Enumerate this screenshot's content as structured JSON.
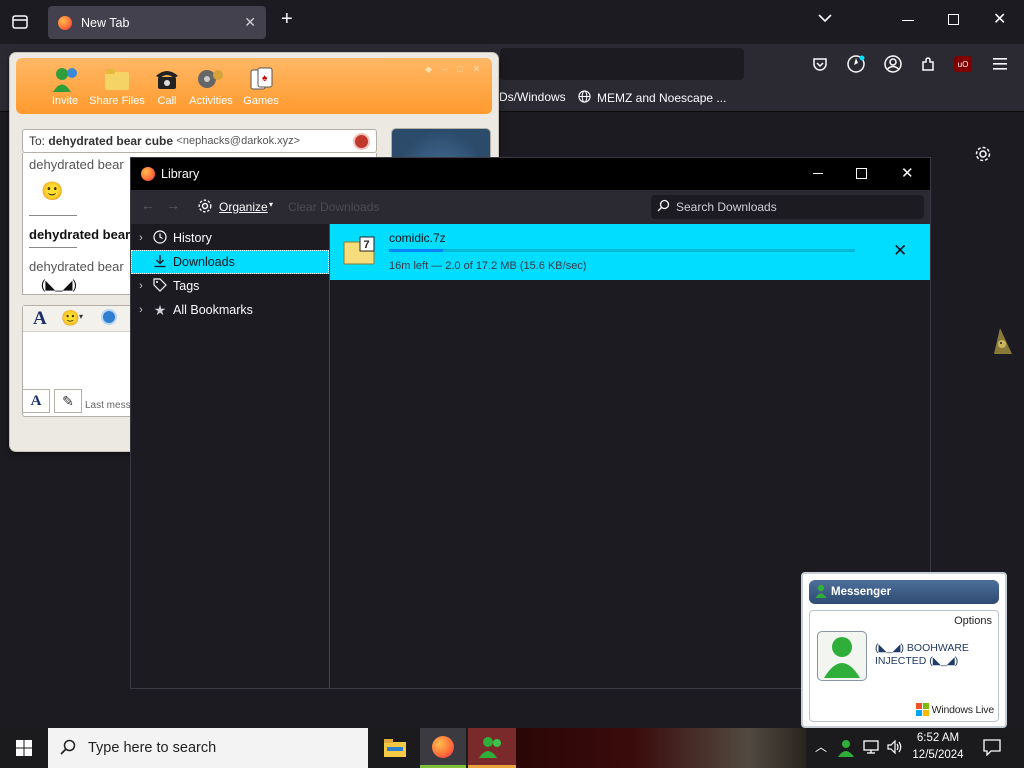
{
  "browser": {
    "tab_title": "New Tab",
    "tab_close": "✕",
    "new_tab": "+",
    "bookmarks": [
      "Ds/Windows",
      "MEMZ and Noescape ..."
    ],
    "ublock_badge": "uO"
  },
  "msn": {
    "toolbar": [
      {
        "label": "Invite",
        "icon": "invite-icon"
      },
      {
        "label": "Share Files",
        "icon": "folder-icon"
      },
      {
        "label": "Call",
        "icon": "phone-icon"
      },
      {
        "label": "Activities",
        "icon": "activities-icon"
      },
      {
        "label": "Games",
        "icon": "games-icon"
      }
    ],
    "to_prefix": "To:",
    "to_name": "dehydrated bear cube",
    "to_email": "<nephacks@darkok.xyz>",
    "conversation": [
      {
        "text": "dehydrated bear",
        "bold": false
      },
      {
        "text": "🙂",
        "bold": false
      },
      {
        "text": "dehydrated bear",
        "bold": true
      },
      {
        "text": "dehydrated bear",
        "bold": false
      },
      {
        "text": "(◣_◢)",
        "bold": false
      }
    ],
    "last_message": "Last mess"
  },
  "library": {
    "title": "Library",
    "organize": "Organize",
    "clear_downloads": "Clear Downloads",
    "search_placeholder": "Search Downloads",
    "sidebar": [
      {
        "label": "History",
        "icon": "clock-icon",
        "expandable": true
      },
      {
        "label": "Downloads",
        "icon": "download-icon",
        "expandable": false
      },
      {
        "label": "Tags",
        "icon": "tag-icon",
        "expandable": true
      },
      {
        "label": "All Bookmarks",
        "icon": "star-icon",
        "expandable": true
      }
    ],
    "download": {
      "filename": "comidic.7z",
      "status": "16m left — 2.0 of 17.2 MB (15.6 KB/sec)",
      "progress": 0.116
    }
  },
  "toast": {
    "title": "Messenger",
    "options": "Options",
    "message": "(◣_◢) BOOHWARE INJECTED (◣_◢)",
    "brand": "Windows Live"
  },
  "taskbar": {
    "search_placeholder": "Type here to search",
    "time": "6:52 AM",
    "date": "12/5/2024"
  },
  "colors": {
    "accent": "#00ddff",
    "msn_orange": "#ff9a2e",
    "firefox_dark": "#1c1b22"
  }
}
